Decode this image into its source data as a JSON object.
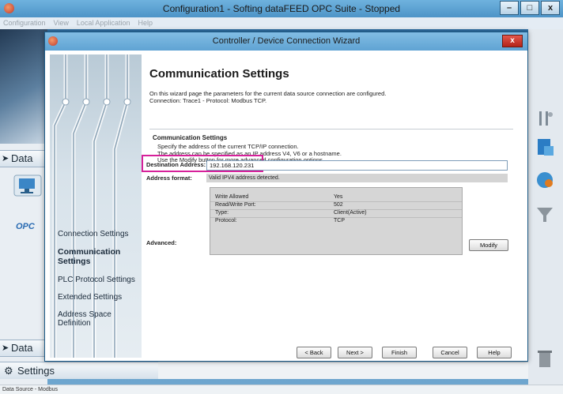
{
  "main_window": {
    "title": "Configuration1 - Softing dataFEED OPC Suite - Stopped",
    "controls": {
      "minimize": "–",
      "maximize": "□",
      "close": "x"
    }
  },
  "menu": [
    "Configuration",
    "View",
    "Local Application",
    "Help"
  ],
  "left_pane": {
    "data_item_1": "Data",
    "data_item_2": "Data",
    "settings": "Settings",
    "opc_logo": "OPC"
  },
  "statusbar": {
    "text": "Data Source - Modbus"
  },
  "dialog": {
    "title": "Controller / Device Connection Wizard",
    "close": "x",
    "heading": "Communication Settings",
    "description_line1": "On this wizard page the parameters for the current data source connection are configured.",
    "description_line2": "Connection: Trace1 - Protocol: Modbus TCP.",
    "steps": [
      {
        "label": "Connection Settings"
      },
      {
        "label": "Communication",
        "label2": "Settings"
      },
      {
        "label": "PLC Protocol Settings"
      },
      {
        "label": "Extended Settings"
      },
      {
        "label": "Address Space Definition"
      }
    ],
    "group": {
      "title": "Communication Settings",
      "desc_line1": "Specify the address of the current TCP/IP connection.",
      "desc_line2": "The address can be specified as an IP address V4, V6 or a  hostname.",
      "desc_line3": "Use the Modify button for more advanced configuration options."
    },
    "destination_label": "Destination Address:",
    "destination_value": "192.168.120.231",
    "address_format_label": "Address format:",
    "address_format_value": "Valid IPV4 address detected.",
    "advanced_label": "Advanced:",
    "advanced_rows": [
      {
        "key": "Write Allowed",
        "value": "Yes"
      },
      {
        "key": "Read/Write Port:",
        "value": "502"
      },
      {
        "key": "Type:",
        "value": "Client(Active)"
      },
      {
        "key": "Protocol:",
        "value": "TCP"
      }
    ],
    "modify_button": "Modify",
    "buttons": {
      "back": "< Back",
      "next": "Next >",
      "finish": "Finish",
      "cancel": "Cancel",
      "help": "Help"
    }
  }
}
